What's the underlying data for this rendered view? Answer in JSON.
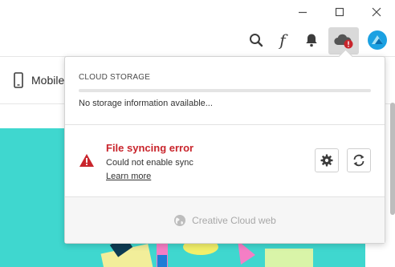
{
  "window": {
    "controls": [
      "minimize",
      "maximize",
      "close"
    ]
  },
  "toolbar": {
    "icons": [
      "search-icon",
      "fonts-icon",
      "bell-icon",
      "cloud-error-icon",
      "avatar"
    ]
  },
  "subnav": {
    "mobile_label": "Mobile"
  },
  "popover": {
    "storage_heading": "CLOUD STORAGE",
    "storage_info": "No storage information available...",
    "error_title": "File syncing error",
    "error_detail": "Could not enable sync",
    "learn_more": "Learn more",
    "footer_link": "Creative Cloud web"
  },
  "colors": {
    "error_red": "#c9252c",
    "accent_teal": "#3fd7cf",
    "avatar_blue": "#1ba1e2"
  }
}
